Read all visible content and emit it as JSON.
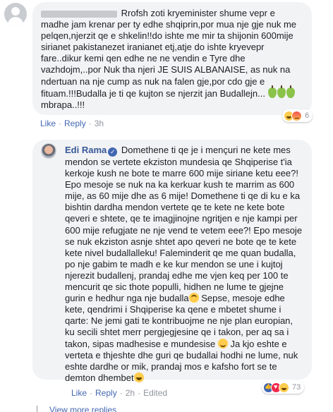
{
  "comment1": {
    "text_p1": "Rrofsh zoti kryeminister shume vepr e madhe jam krenar per ty edhe shqiprin,por mua nje gje nuk me pelqen,njerzit qe e shkelin!!do ishte me mir ta shijonin 600mije sirianet pakistanezet iranianet etj,atje do ishte kryevepr fare..dikur kemi qen edhe ne ne vendin e Tyre dhe vazhdojm,..por Nuk tha njeri JE SUIS ALBANAISE, as nuk na ndertuan na nje cump as nuk na falen gje,por cdo gje e fituam.!!!Budalla je ti qe kujton se njerzit jan Budallejn...",
    "text_p2": "mbrapa..!!!",
    "like_label": "Like",
    "reply_label": "Reply",
    "time": "3h",
    "reaction_count": "6"
  },
  "comment2": {
    "author": "Edi Rama",
    "text_p1": "Domethene ti qe je i mençuri ne kete mes mendon se vertete ekziston mundesia qe Shqiperise t'ia kerkoje kush ne bote te marre 600 mije siriane ketu eee?! Epo mesoje se nuk na ka kerkuar kush te marrim as 600 mije, as 60 mije dhe as 6 mije! Domethene ti qe di ku e ka bishtin dardha mendon vertete qe te kete ne kete bote qeveri e shtete, qe te imagjinojne ngritjen e nje kampi per 600 mije refugjate ne nje vend te vetem eee?! Epo mesoje se nuk ekziston asnje shtet apo qeveri ne bote qe te kete kete nivel budallalleku! Faleminderit qe me quan budalla, po nje gabim te madh e ke kur mendon se une i kujtoj njerezit budallenj, prandaj edhe me vjen keq per 100 te mencurit qe sic thote populli, hidhen ne lume te gjejne gurin e hedhur nga nje budalla",
    "text_p2": "Sepse, mesoje edhe kete, qendrimi i Shqiperise ka qene e mbetet shume i qarte: Ne jemi gati te kontribuojme ne nje plan europian, ku secili shtet merr pergjegjesine qe i takon, per aq sa i takon, sipas madhesise e mundesise",
    "text_p3": "Ja kjo eshte e verteta e thjeshte dhe guri qe budallai hodhi ne lume, nuk eshte dardhe or mik, prandaj mos e kafsho fort se te demton dhembet",
    "like_label": "Like",
    "reply_label": "Reply",
    "time": "2h",
    "edited_label": "Edited",
    "reaction_count": "73"
  },
  "view_more": "View more replies",
  "colors": {
    "link": "#385898",
    "action": "#4267b2",
    "bubble": "#f2f3f5",
    "meta": "#90949c"
  }
}
